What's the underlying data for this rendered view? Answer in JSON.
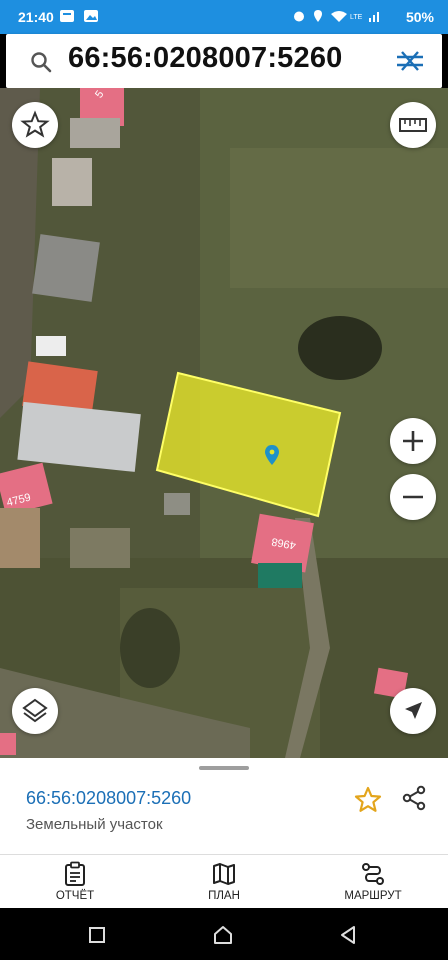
{
  "status_bar": {
    "time": "21:40",
    "battery": "50%"
  },
  "search": {
    "query": "66:56:0208007:5260"
  },
  "map": {
    "parcel_labels": [
      "4759",
      "4968",
      "5"
    ],
    "controls": [
      "favorite-star",
      "ruler",
      "zoom-in",
      "zoom-out",
      "layers",
      "my-location"
    ]
  },
  "info_sheet": {
    "cadastral_number": "66:56:0208007:5260",
    "property_type": "Земельный участок"
  },
  "bottom_nav": {
    "report": "ОТЧЁТ",
    "plan": "ПЛАН",
    "route": "МАРШРУТ"
  },
  "colors": {
    "accent": "#1e8fe0",
    "parcel_fill": "#e3e32b",
    "building_pink": "#e46f84",
    "link": "#1b6fb6"
  }
}
